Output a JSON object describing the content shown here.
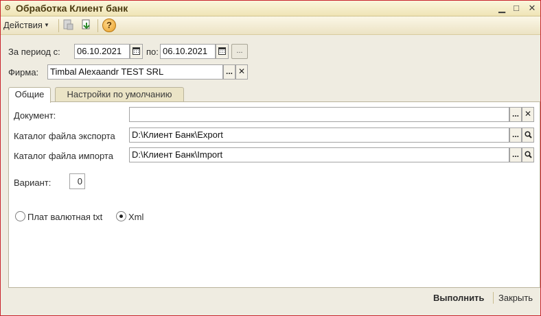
{
  "window": {
    "title": "Обработка  Клиент банк"
  },
  "toolbar": {
    "actions_label": "Действия",
    "help_label": "?"
  },
  "period": {
    "from_label": "За период с:",
    "from_value": "06.10.2021",
    "to_label": "по:",
    "to_value": "06.10.2021",
    "select_button_label": "..."
  },
  "firm": {
    "label": "Фирма:",
    "value": "Timbal Alexaandr TEST SRL"
  },
  "tabs": [
    {
      "label": "Общие",
      "active": true
    },
    {
      "label": "Настройки по умолчанию",
      "active": false
    }
  ],
  "general": {
    "document_label": "Документ:",
    "document_value": "",
    "export_label": "Каталог файла экспорта",
    "export_value": "D:\\Клиент Банк\\Export",
    "import_label": "Каталог файла импорта",
    "import_value": "D:\\Клиент Банк\\Import",
    "variant_label": "Вариант:",
    "variant_value": "0",
    "format_options": [
      {
        "label": "Плат валютная txt",
        "selected": false
      },
      {
        "label": "Xml",
        "selected": true
      }
    ]
  },
  "footer": {
    "execute_label": "Выполнить",
    "close_label": "Закрыть"
  },
  "icons": {
    "ellipsis": "...",
    "clear": "✕",
    "search": "magnifier-icon",
    "calendar": "calendar-icon"
  },
  "colors": {
    "window_border": "#c8232b",
    "title_bg": "#efe4b6",
    "panel_bg": "#efece1"
  }
}
